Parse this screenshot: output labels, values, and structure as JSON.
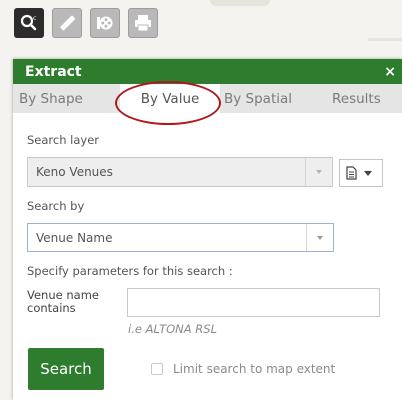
{
  "toolbar": {
    "tools": [
      {
        "name": "search-tool",
        "icon": "magnifier-icon",
        "active": true
      },
      {
        "name": "measure-tool",
        "icon": "ruler-icon",
        "active": false
      },
      {
        "name": "layers-tool",
        "icon": "film-reel-icon",
        "active": false
      },
      {
        "name": "print-tool",
        "icon": "printer-icon",
        "active": false
      }
    ]
  },
  "panel": {
    "title": "Extract",
    "close": "×",
    "tabs": [
      {
        "label": "By Shape",
        "selected": false
      },
      {
        "label": "By Value",
        "selected": true
      },
      {
        "label": "By Spatial",
        "selected": false
      },
      {
        "label": "Results",
        "selected": false
      }
    ]
  },
  "form": {
    "search_layer_label": "Search layer",
    "search_layer_value": "Keno Venues",
    "search_by_label": "Search by",
    "search_by_value": "Venue Name",
    "params_label": "Specify parameters for this search :",
    "venue_label": "Venue name contains",
    "venue_value": "",
    "venue_hint": "i.e ALTONA RSL",
    "search_button": "Search",
    "limit_label": "Limit search to map extent",
    "limit_checked": false
  },
  "colors": {
    "header_green": "#2e7d2e",
    "annotation_red": "#b0191e"
  }
}
